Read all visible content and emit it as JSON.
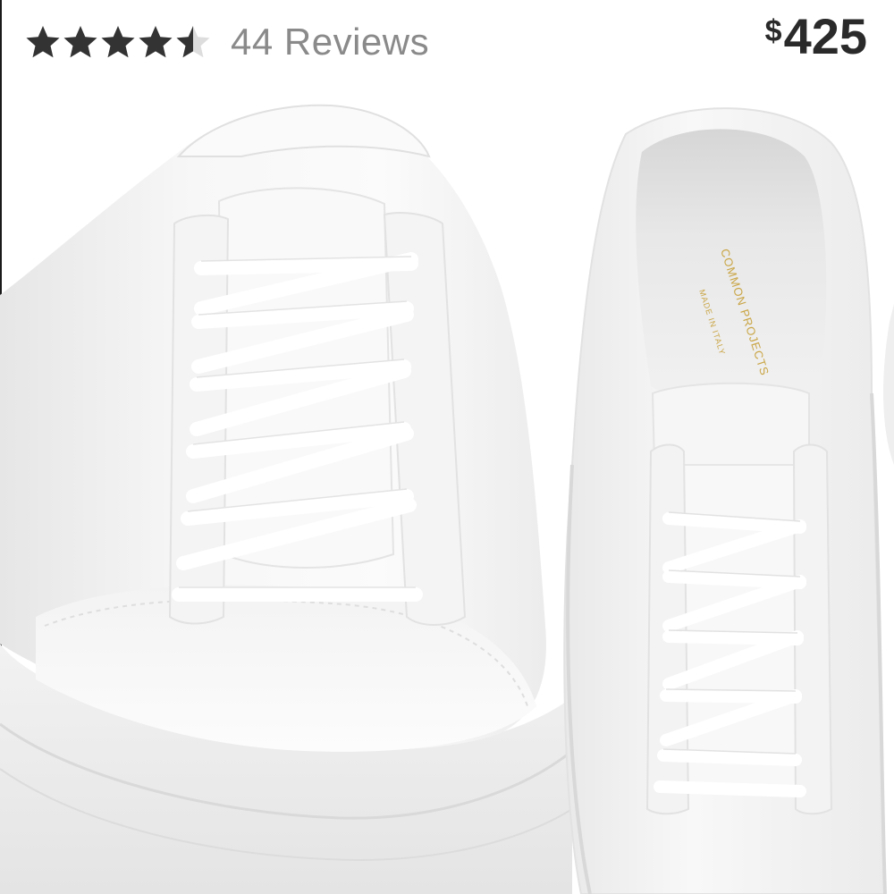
{
  "rating": {
    "value": 4.5,
    "max": 5,
    "reviews_label": "44 Reviews",
    "filled_color": "#333333",
    "empty_color": "#dddddd"
  },
  "price": {
    "currency": "$",
    "amount": "425"
  },
  "product_image": {
    "insole_brand": "COMMON PROJECTS",
    "insole_origin": "MADE IN ITALY",
    "insole_text_color": "#c9a545"
  }
}
